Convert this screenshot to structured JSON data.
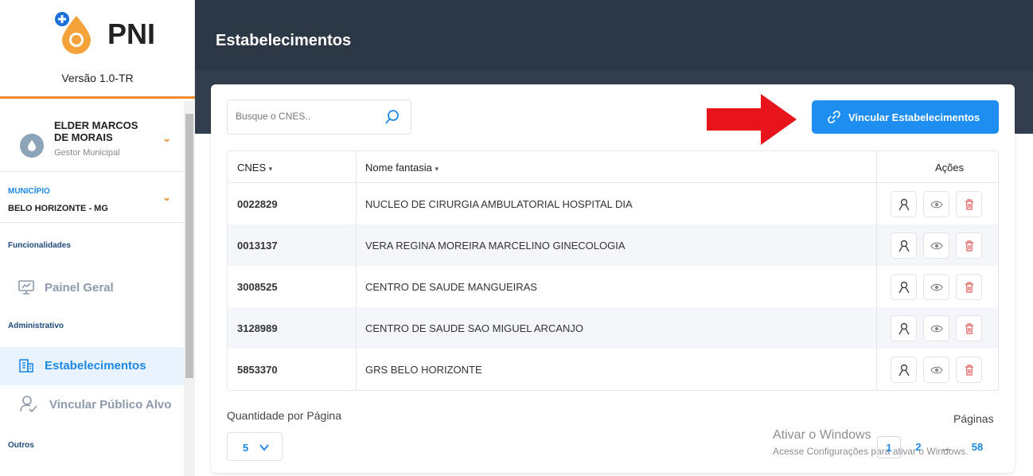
{
  "app": {
    "name": "PNI",
    "version": "Versão 1.0-TR"
  },
  "user": {
    "name": "ELDER MARCOS DE MORAIS",
    "role": "Gestor Municipal"
  },
  "municipio": {
    "label": "MUNICÍPIO",
    "value": "BELO HORIZONTE - MG"
  },
  "sidebar": {
    "sections": {
      "funcionalidades": "Funcionalidades",
      "administrativo": "Administrativo",
      "outros": "Outros"
    },
    "items": [
      {
        "label": "Painel Geral",
        "icon": "dashboard-icon",
        "active": false
      },
      {
        "label": "Estabelecimentos",
        "icon": "building-icon",
        "active": true
      },
      {
        "label": "Vincular Público Alvo",
        "icon": "user-check-icon",
        "active": false
      }
    ]
  },
  "header": {
    "title": "Estabelecimentos"
  },
  "search": {
    "placeholder": "Busque o CNES..",
    "value": ""
  },
  "toolbar": {
    "link_label": "Vincular Estabelecimentos"
  },
  "table": {
    "columns": [
      "CNES",
      "Nome fantasia",
      "Ações"
    ],
    "rows": [
      {
        "cnes": "0022829",
        "nome": "NUCLEO DE CIRURGIA AMBULATORIAL HOSPITAL DIA"
      },
      {
        "cnes": "0013137",
        "nome": "VERA REGINA MOREIRA MARCELINO GINECOLOGIA"
      },
      {
        "cnes": "3008525",
        "nome": "CENTRO DE SAUDE MANGUEIRAS"
      },
      {
        "cnes": "3128989",
        "nome": "CENTRO DE SAUDE SAO MIGUEL ARCANJO"
      },
      {
        "cnes": "5853370",
        "nome": "GRS BELO HORIZONTE"
      }
    ]
  },
  "pagination": {
    "per_page_label": "Quantidade por Página",
    "per_page_value": "5",
    "pages_label": "Páginas",
    "pages": [
      "1",
      "2",
      "...",
      "58"
    ],
    "current": "1"
  },
  "watermark": {
    "title": "Ativar o Windows",
    "subtitle": "Acesse Configurações para ativar o Windows."
  },
  "colors": {
    "primary": "#1e8ef0",
    "sidebar_accent": "#f28a2e",
    "header_bg": "#2d3846",
    "delete": "#e57373",
    "arrow": "#e8141b"
  }
}
